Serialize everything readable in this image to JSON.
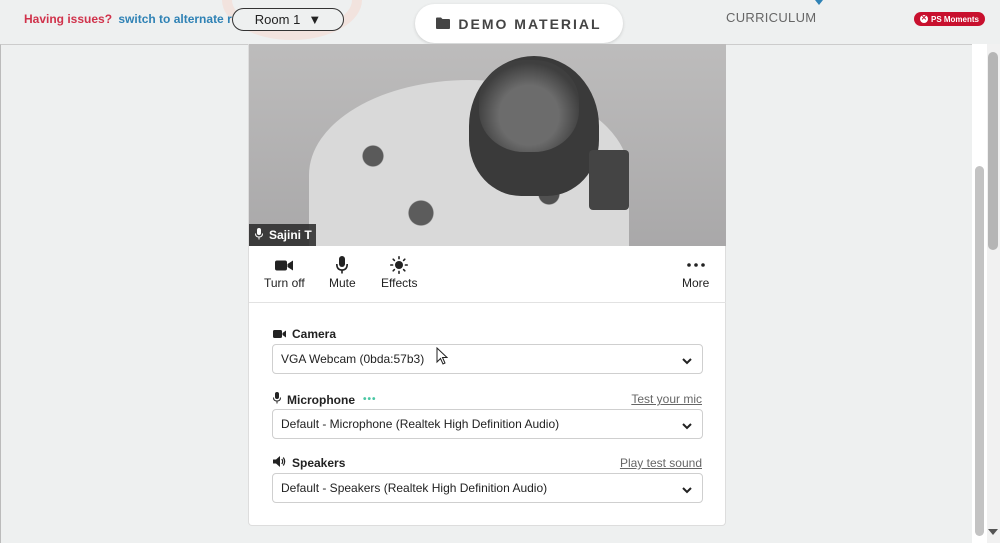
{
  "topbar": {
    "issues_text": "Having issues?",
    "switch_link": "switch to alternate room",
    "room_value": "Room 1",
    "demo_button": "DEMO MATERIAL",
    "curriculum": "CURRICULUM",
    "ps_badge": "PS Moments"
  },
  "video": {
    "participant_name": "Sajini T"
  },
  "controls": {
    "turn_off": "Turn off",
    "mute": "Mute",
    "effects": "Effects",
    "more": "More"
  },
  "devices": {
    "camera_label": "Camera",
    "camera_value": "VGA Webcam (0bda:57b3)",
    "microphone_label": "Microphone",
    "microphone_value": "Default - Microphone (Realtek High Definition Audio)",
    "test_mic": "Test your mic",
    "speakers_label": "Speakers",
    "speakers_value": "Default - Speakers (Realtek High Definition Audio)",
    "play_test": "Play test sound"
  },
  "colors": {
    "issues": "#d0324b",
    "link": "#2f82b5",
    "badge": "#c8102e",
    "mic_level": "#4bc7a4"
  },
  "icons": [
    "folder-icon",
    "caret-down-icon",
    "x-circle-icon",
    "microphone-icon",
    "video-camera-icon",
    "sun-icon",
    "more-dots-icon",
    "speaker-icon",
    "chevron-down-icon",
    "mouse-cursor-icon"
  ]
}
